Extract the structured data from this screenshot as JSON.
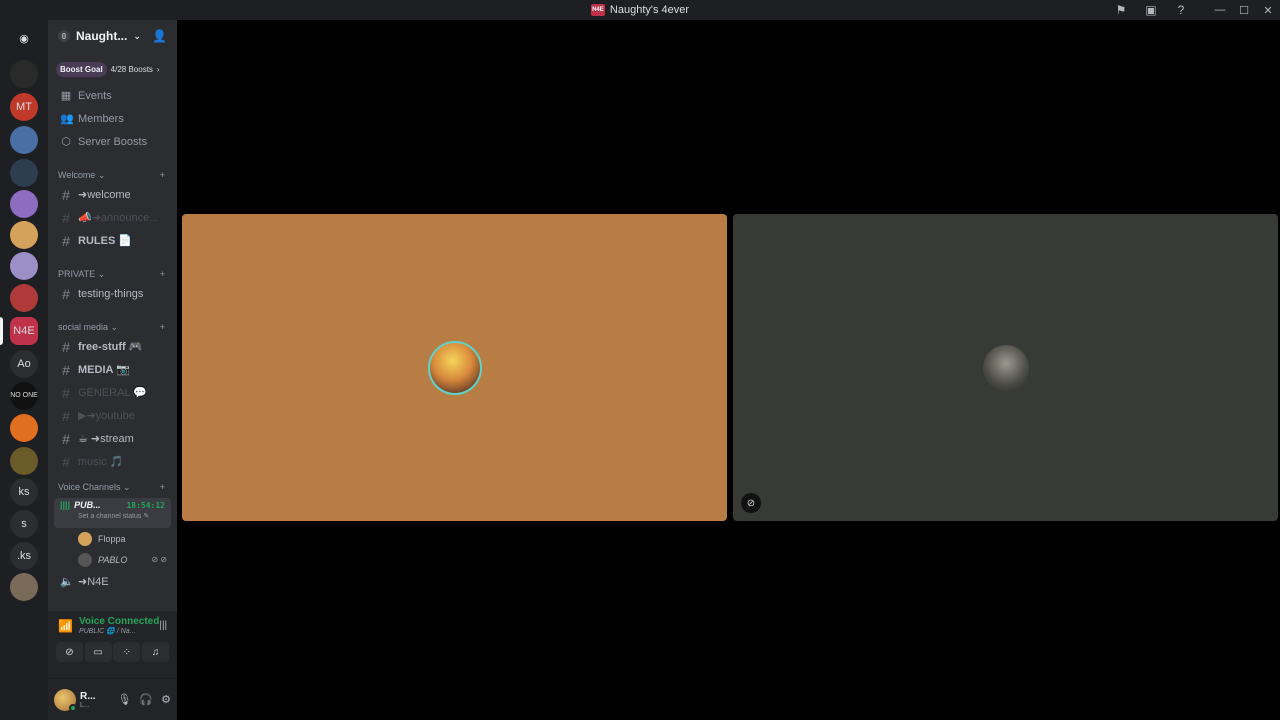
{
  "window": {
    "title": "Naughty's 4ever",
    "title_logo": "N4E"
  },
  "servers": [
    {
      "label": "",
      "icon": "discord-home-icon",
      "color": "#1e1f22"
    },
    {
      "label": "",
      "icon": "server-avatar",
      "color": "#2a2a2a"
    },
    {
      "label": "MT",
      "icon": "server-avatar",
      "color": "#c0392b"
    },
    {
      "label": "",
      "icon": "server-avatar",
      "color": "#4a6fa5"
    },
    {
      "label": "",
      "icon": "server-avatar",
      "color": "#2c3e50"
    },
    {
      "label": "",
      "icon": "server-avatar",
      "color": "#8e6cc0"
    },
    {
      "label": "",
      "icon": "server-avatar",
      "color": "#d4a25a"
    },
    {
      "label": "",
      "icon": "server-avatar",
      "color": "#9b8fc7"
    },
    {
      "label": "",
      "icon": "server-avatar",
      "color": "#b03a3a"
    },
    {
      "label": "N4E",
      "icon": "server-avatar",
      "color": "#c0324a"
    },
    {
      "label": "Ao",
      "icon": "server-avatar",
      "color": "#2b2d31"
    },
    {
      "label": "NO ONE",
      "icon": "server-avatar",
      "color": "#111111"
    },
    {
      "label": "",
      "icon": "server-avatar",
      "color": "#e07020"
    },
    {
      "label": "",
      "icon": "server-avatar",
      "color": "#6b5a2a"
    },
    {
      "label": "ks",
      "icon": "server-avatar",
      "color": "#2b2d31"
    },
    {
      "label": "s",
      "icon": "server-avatar",
      "color": "#2b2d31"
    },
    {
      "label": ".ks",
      "icon": "server-avatar",
      "color": "#2b2d31"
    },
    {
      "label": "",
      "icon": "server-avatar",
      "color": "#7a6a5a"
    }
  ],
  "sidebar": {
    "server_name": "Naught...",
    "boost_count_badge": "0",
    "boost_goal_label": "Boost Goal",
    "boost_progress": "4/28 Boosts",
    "nav": [
      {
        "label": "Events",
        "icon": "calendar-icon"
      },
      {
        "label": "Members",
        "icon": "members-icon"
      },
      {
        "label": "Server Boosts",
        "icon": "boost-icon"
      }
    ],
    "categories": [
      {
        "name": "Welcome",
        "channels": [
          {
            "label": "➜welcome",
            "muted": false
          },
          {
            "label": "📣➜announce...",
            "muted": true
          },
          {
            "label": "RULES 📄",
            "muted": false
          }
        ]
      },
      {
        "name": "PRIVATE",
        "channels": [
          {
            "label": "testing-things",
            "muted": false
          }
        ]
      },
      {
        "name": "social media",
        "channels": [
          {
            "label": "free-stuff 🎮",
            "muted": false
          },
          {
            "label": "MEDIA 📷",
            "muted": false
          },
          {
            "label": "GENERAL 💬",
            "muted": true
          },
          {
            "label": "▶➜youtube",
            "muted": true
          },
          {
            "label": "☕ ➜stream",
            "muted": false
          },
          {
            "label": "music 🎵",
            "muted": true
          }
        ]
      }
    ],
    "voice_category": "Voice Channels",
    "voice_active": {
      "name": "PUB...",
      "time": "18:54:12",
      "status": "Set a channel status"
    },
    "voice_users": [
      {
        "name": "Floppa",
        "color": "#d4a25a"
      },
      {
        "name": "PABLO",
        "color": "#555555"
      }
    ],
    "voice_other": "➜N4E"
  },
  "voice_panel": {
    "title": "Voice Connected",
    "subtitle": "PUBLIC 🌐 / Na..."
  },
  "user_panel": {
    "name": "R...",
    "sub": "L..."
  },
  "stage": {
    "left_tile_color": "#b87d44",
    "right_tile_color": "#383a36"
  }
}
